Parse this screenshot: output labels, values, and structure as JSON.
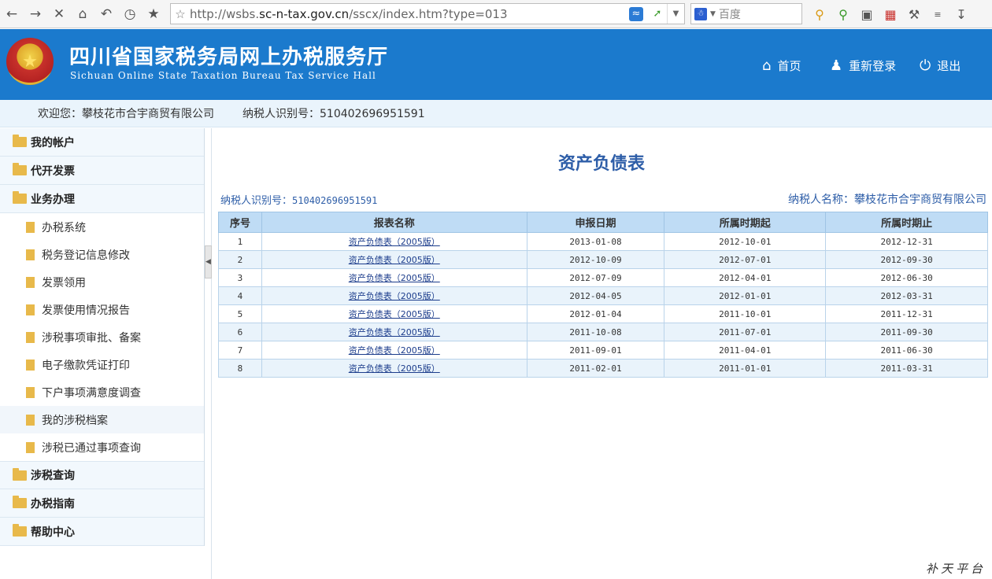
{
  "browser": {
    "url_prefix": "http://wsbs.",
    "url_host": "sc-n-tax.gov.cn",
    "url_path": "/sscx/index.htm?type=013",
    "search_placeholder": "百度"
  },
  "header": {
    "title": "四川省国家税务局网上办税服务厅",
    "subtitle": "Sichuan Online State Taxation Bureau Tax Service Hall",
    "nav": [
      {
        "label": "首页",
        "icon": "home-icon"
      },
      {
        "label": "重新登录",
        "icon": "users-icon"
      },
      {
        "label": "退出",
        "icon": "power-icon"
      }
    ]
  },
  "welcome": {
    "user_text": "欢迎您：攀枝花市合宇商贸有限公司",
    "taxid_text": "纳税人识别号：510402696951591"
  },
  "sidebar": {
    "top_items": [
      "我的帐户",
      "代开发票",
      "业务办理"
    ],
    "sub_items": [
      "办税系统",
      "税务登记信息修改",
      "发票领用",
      "发票使用情况报告",
      "涉税事项审批、备案",
      "电子缴款凭证打印",
      "下户事项满意度调查",
      "我的涉税档案",
      "涉税已通过事项查询"
    ],
    "bottom_items": [
      "涉税查询",
      "办税指南",
      "帮助中心"
    ]
  },
  "main": {
    "title": "资产负债表",
    "taxid_label": "纳税人识别号：",
    "taxid_value": "510402696951591",
    "name_label": "纳税人名称：",
    "name_value": "攀枝花市合宇商贸有限公司",
    "columns": [
      "序号",
      "报表名称",
      "申报日期",
      "所属时期起",
      "所属时期止"
    ],
    "rows": [
      [
        "1",
        "资产负债表（2005版）",
        "2013-01-08",
        "2012-10-01",
        "2012-12-31"
      ],
      [
        "2",
        "资产负债表（2005版）",
        "2012-10-09",
        "2012-07-01",
        "2012-09-30"
      ],
      [
        "3",
        "资产负债表（2005版）",
        "2012-07-09",
        "2012-04-01",
        "2012-06-30"
      ],
      [
        "4",
        "资产负债表（2005版）",
        "2012-04-05",
        "2012-01-01",
        "2012-03-31"
      ],
      [
        "5",
        "资产负债表（2005版）",
        "2012-01-04",
        "2011-10-01",
        "2011-12-31"
      ],
      [
        "6",
        "资产负债表（2005版）",
        "2011-10-08",
        "2011-07-01",
        "2011-09-30"
      ],
      [
        "7",
        "资产负债表（2005版）",
        "2011-09-01",
        "2011-04-01",
        "2011-06-30"
      ],
      [
        "8",
        "资产负债表（2005版）",
        "2011-02-01",
        "2011-01-01",
        "2011-03-31"
      ]
    ]
  },
  "watermark": "补天平台"
}
